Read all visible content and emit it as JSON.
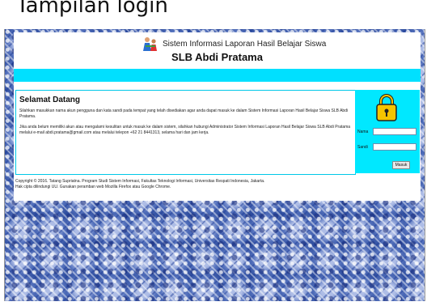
{
  "caption": "Tampilan login",
  "header": {
    "app_title": "Sistem Informasi Laporan Hasil Belajar Siswa",
    "school_name": "SLB Abdi Pratama"
  },
  "welcome": {
    "title": "Selamat Datang",
    "paragraph1": "Silahkan masukkan nama akun pengguna dan kata sandi pada tempat yang telah disediakan agar anda dapat masuk ke dalam Sistem Informasi Laporan Hasil Belajar Siswa SLB Abdi Pratama.",
    "paragraph2": "Jika anda belum memiliki akun atau mengalami kesulitan untuk masuk ke dalam sistem, silahkan hubungi Administrator Sistem Informasi Laporan Hasil Belajar Siswa SLB Abdi Pratama melalui e-mail abdi.pratama@gmail.com atau melalui telepon +62 21 8441313, selama hari dan jam kerja."
  },
  "login": {
    "username_label": "Nama",
    "password_label": "Sandi",
    "username_value": "",
    "password_value": "",
    "submit_label": "Masuk"
  },
  "footer": {
    "line1": "Copyright © 2016. Tatang Supriatna. Program Studi Sistem Informasi, Fakultas Teknologi Informasi, Universitas Respati Indonesia, Jakarta.",
    "line2": "Hak cipta dilindungi UU. Gunakan peramban web Mozilla Firefox atau Google Chrome."
  },
  "colors": {
    "accent": "#00e0ff",
    "batik_background": "#6a83c6",
    "lock": "#f5c400"
  },
  "icons": {
    "logo": "student-logo",
    "lock": "padlock-icon"
  }
}
